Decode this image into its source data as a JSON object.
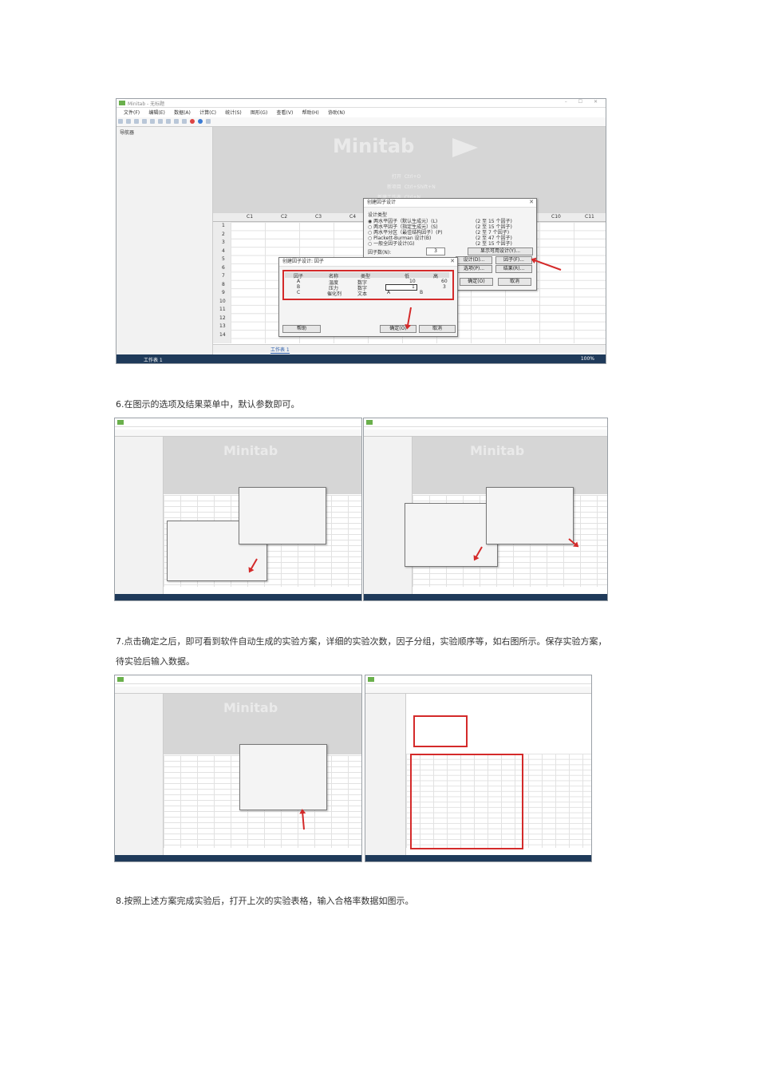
{
  "captions": {
    "step6": "6.在图示的选项及结果菜单中，默认参数即可。",
    "step7_line1": "7.点击确定之后，即可看到软件自动生成的实验方案，详细的实验次数，因子分组，实验顺序等，如右图所示。保存实验方案，",
    "step7_line2": "待实验后输入数据。",
    "step8": "8.按照上述方案完成实验后，打开上次的实验表格，输入合格率数据如图示。"
  },
  "app": {
    "title": "Minitab - 无标题",
    "menus": [
      "文件(F)",
      "编辑(E)",
      "数据(A)",
      "计算(C)",
      "统计(S)",
      "图形(G)",
      "查看(V)",
      "帮助(H)",
      "协助(N)"
    ],
    "navigator": "导航器",
    "logo": "Minitab",
    "quick": [
      {
        "label": "打开",
        "key": "Ctrl+O"
      },
      {
        "label": "新项目",
        "key": "Ctrl+Shift+N"
      },
      {
        "label": "新建工作表",
        "key": "Ctrl+N"
      }
    ],
    "columns": [
      "C1",
      "C2",
      "C3",
      "C4"
    ],
    "columns_right": [
      "C10",
      "C11"
    ],
    "rows": [
      "1",
      "2",
      "3",
      "4",
      "5",
      "6",
      "7",
      "8",
      "9",
      "10",
      "11",
      "12",
      "13",
      "14"
    ],
    "sheet_tab": "工作表 1",
    "status_left": "工作表 1",
    "zoom": "100%"
  },
  "factorial_dialog": {
    "title": "创建因子设计",
    "section": "设计类型",
    "options": [
      {
        "label": "两水平因子（默认生成元）(L)",
        "range": "(2 至 15 个因子)"
      },
      {
        "label": "两水平因子（指定生成元）(S)",
        "range": "(2 至 15 个因子)"
      },
      {
        "label": "两水平分区（最佳结构因子）(P)",
        "range": "(2 至 7 个因子)"
      },
      {
        "label": "Plackett-Burman 设计(B)",
        "range": "(2 至 47 个因子)"
      },
      {
        "label": "一般全因子设计(G)",
        "range": "(2 至 15 个因子)"
      }
    ],
    "factor_count_label": "因子数(N):",
    "factor_count": "3",
    "show_designs": "显示可用设计(Y)...",
    "design_btn": "设计(D)...",
    "factors_btn": "因子(F)...",
    "options_btn": "选项(P)...",
    "results_btn": "结果(R)...",
    "ok": "确定(O)",
    "cancel": "取消"
  },
  "factor_dialog": {
    "title": "创建因子设计: 因子",
    "headers": [
      "因子",
      "名称",
      "类型",
      "低",
      "高"
    ],
    "rows": [
      {
        "factor": "A",
        "name": "温度",
        "type": "数字",
        "low": "10",
        "high": "60"
      },
      {
        "factor": "B",
        "name": "压力",
        "type": "数字",
        "low": "1",
        "high": "3"
      },
      {
        "factor": "C",
        "name": "催化剂",
        "type": "文本",
        "low": "A",
        "high": "B"
      }
    ],
    "help": "帮助",
    "ok": "确定(O)",
    "cancel": "取消"
  }
}
